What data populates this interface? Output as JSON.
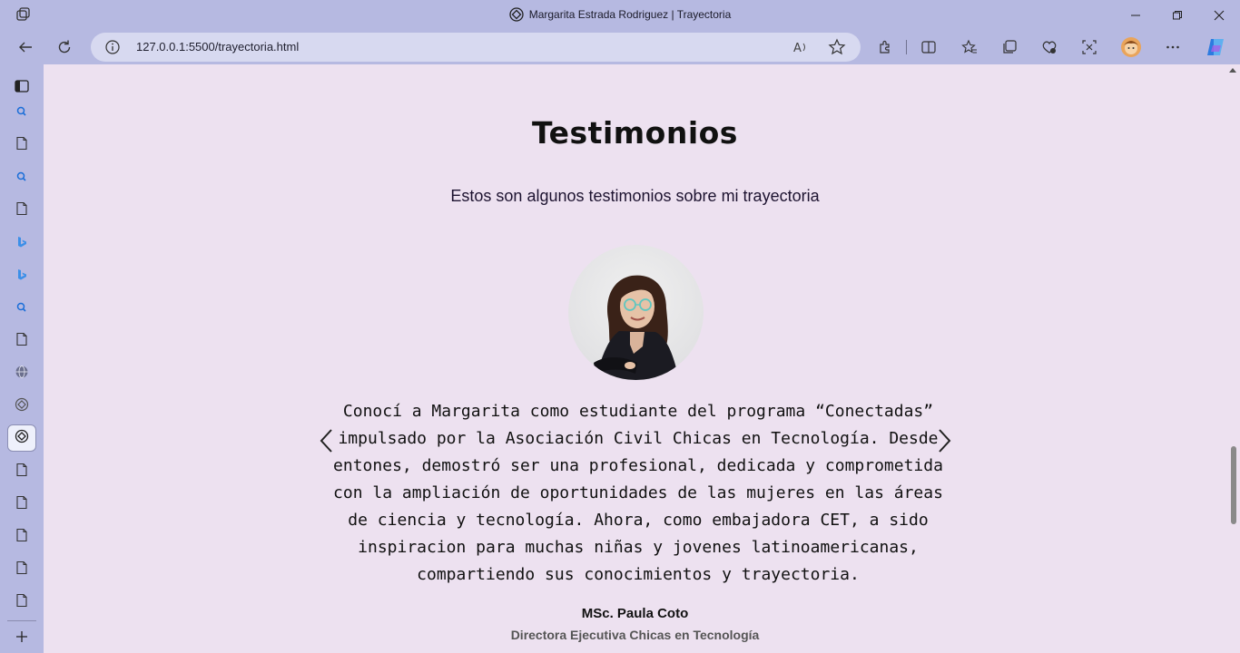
{
  "window": {
    "title": "Margarita Estrada Rodriguez | Trayectoria"
  },
  "toolbar": {
    "url": "127.0.0.1:5500/trayectoria.html"
  },
  "content": {
    "heading": "Testimonios",
    "subheading": "Estos son algunos testimonios sobre mi trayectoria",
    "testimonial": {
      "quote": "Conocí a Margarita como estudiante del programa “Conectadas” impulsado por la Asociación Civil Chicas en Tecnología. Desde entones, demostró ser una profesional, dedicada y comprometida con la ampliación de oportunidades de las mujeres en las áreas de ciencia y tecnología. Ahora, como embajadora CET, a sido inspiracion para muchas niñas y jovenes latinoamericanas, compartiendo sus conocimientos y trayectoria.",
      "author": "MSc. Paula Coto",
      "role": "Directora Ejecutiva Chicas en Tecnología"
    }
  },
  "sidebar": {
    "items": [
      "search-icon",
      "document-icon",
      "search-icon",
      "document-icon",
      "bing-icon",
      "bing-icon",
      "search-icon",
      "document-icon",
      "globe-icon",
      "site-icon",
      "site-icon",
      "document-icon",
      "document-icon",
      "document-icon",
      "document-icon",
      "document-icon"
    ]
  },
  "colors": {
    "chrome": "#b6b9e1",
    "page_background": "#ede1f0",
    "text": "#111111"
  }
}
